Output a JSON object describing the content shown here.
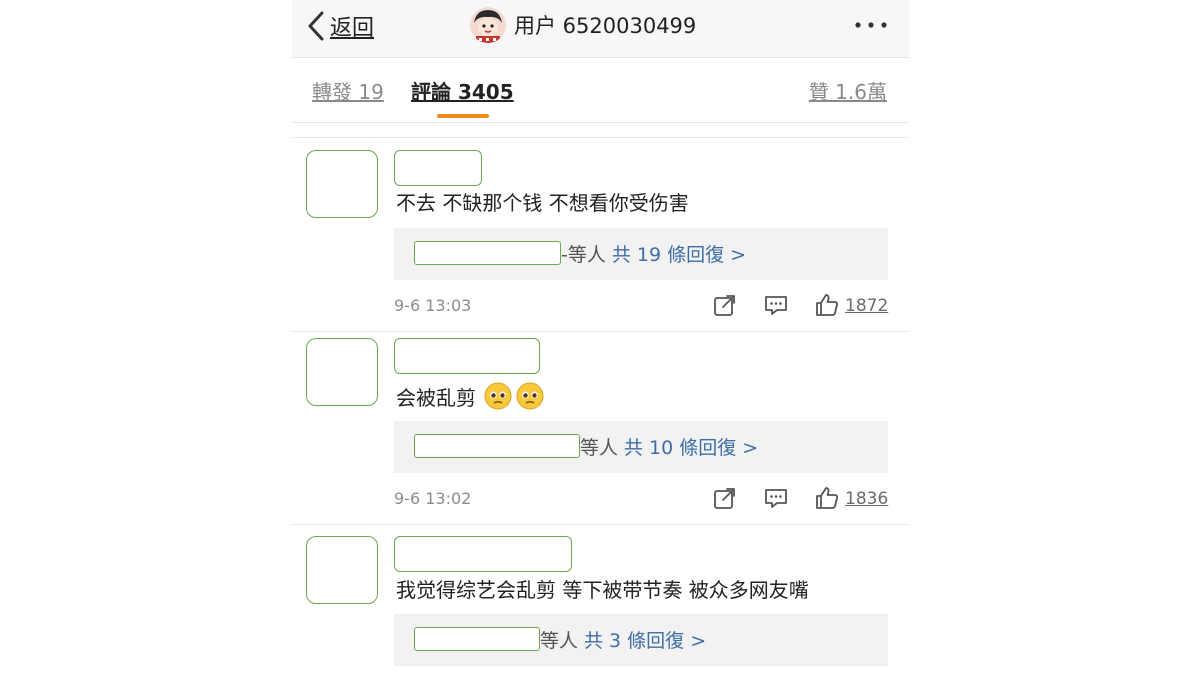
{
  "navbar": {
    "back_label": "返回",
    "username": "用户 6520030499",
    "more_icon": "more-dots-icon"
  },
  "tabs": {
    "repost": "轉發 19",
    "comments": "評論 3405",
    "likes": "贊 1.6萬",
    "active": "comments",
    "accent_color": "#f08a1c"
  },
  "comments": [
    {
      "text": "不去 不缺那个钱 不想看你受伤害",
      "reply_suffix": "-等人",
      "reply_link": "共 19 條回復 >",
      "timestamp": "9-6 13:03",
      "like_count": "1872"
    },
    {
      "text": "会被乱剪",
      "emoji": [
        "pleading-face-icon",
        "pleading-face-icon"
      ],
      "reply_suffix": "等人",
      "reply_link": "共 10 條回復 >",
      "timestamp": "9-6 13:02",
      "like_count": "1836"
    },
    {
      "text": "我觉得综艺会乱剪 等下被带节奏 被众多网友嘴",
      "reply_suffix": "等人",
      "reply_link": "共 3 條回復 >"
    }
  ],
  "colors": {
    "link": "#3d6ea8",
    "redaction_border": "#6aa84f"
  }
}
